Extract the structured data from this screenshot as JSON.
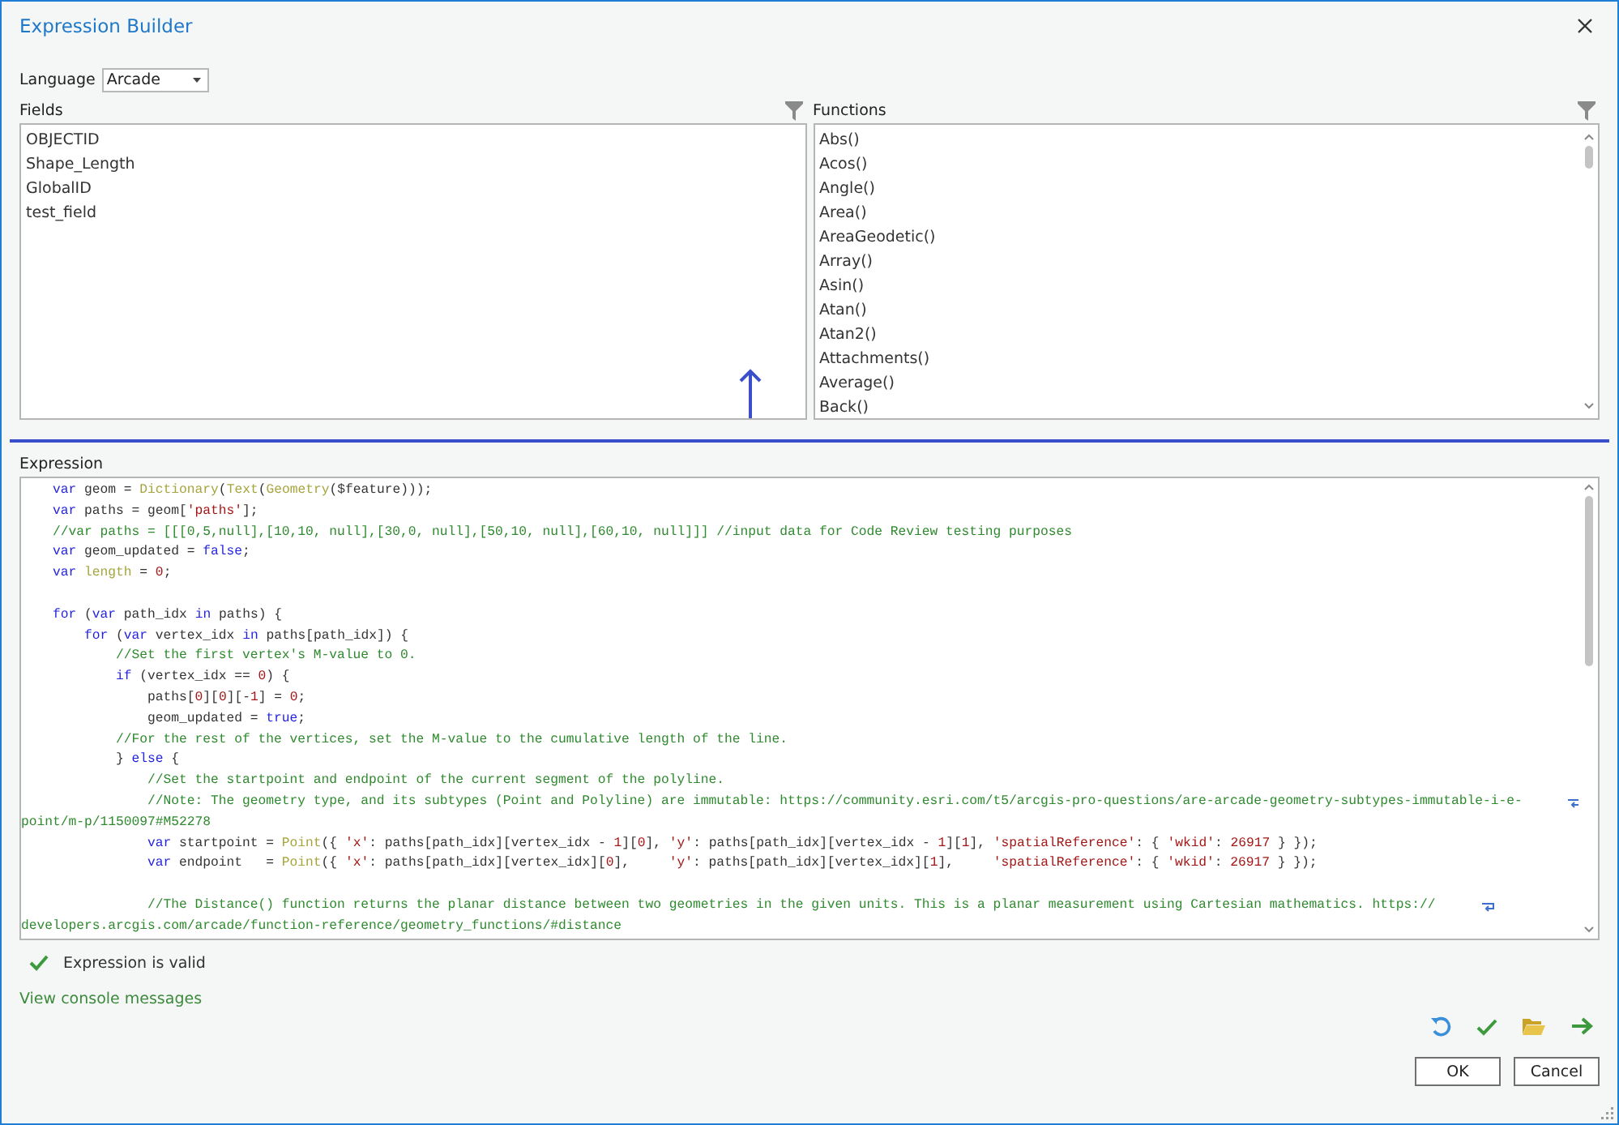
{
  "window": {
    "title": "Expression Builder"
  },
  "language": {
    "label": "Language",
    "value": "Arcade"
  },
  "fields": {
    "label": "Fields",
    "items": [
      "OBJECTID",
      "Shape_Length",
      "GlobalID",
      "test_field"
    ]
  },
  "functions": {
    "label": "Functions",
    "items": [
      "Abs()",
      "Acos()",
      "Angle()",
      "Area()",
      "AreaGeodetic()",
      "Array()",
      "Asin()",
      "Atan()",
      "Atan2()",
      "Attachments()",
      "Average()",
      "Back()"
    ]
  },
  "expression": {
    "label": "Expression",
    "lines": [
      {
        "kind": "code",
        "tokens": [
          {
            "kind": "kw",
            "text": "    var"
          },
          {
            "kind": "pl",
            "text": " geom = "
          },
          {
            "kind": "fn",
            "text": "Dictionary"
          },
          {
            "kind": "pl",
            "text": "("
          },
          {
            "kind": "fn",
            "text": "Text"
          },
          {
            "kind": "pl",
            "text": "("
          },
          {
            "kind": "fn",
            "text": "Geometry"
          },
          {
            "kind": "pl",
            "text": "($feature)));"
          }
        ]
      },
      {
        "kind": "code",
        "tokens": [
          {
            "kind": "kw",
            "text": "    var"
          },
          {
            "kind": "pl",
            "text": " paths = geom["
          },
          {
            "kind": "str",
            "text": "'paths'"
          },
          {
            "kind": "pl",
            "text": "];"
          }
        ]
      },
      {
        "kind": "code",
        "tokens": [
          {
            "kind": "com",
            "text": "    //var paths = [[[0,5,null],[10,10, null],[30,0, null],[50,10, null],[60,10, null]]] //input data for Code Review testing purposes"
          }
        ]
      },
      {
        "kind": "code",
        "tokens": [
          {
            "kind": "kw",
            "text": "    var"
          },
          {
            "kind": "pl",
            "text": " geom_updated = "
          },
          {
            "kind": "kw",
            "text": "false"
          },
          {
            "kind": "pl",
            "text": ";"
          }
        ]
      },
      {
        "kind": "code",
        "tokens": [
          {
            "kind": "kw",
            "text": "    var "
          },
          {
            "kind": "fn",
            "text": "length"
          },
          {
            "kind": "pl",
            "text": " = "
          },
          {
            "kind": "num",
            "text": "0"
          },
          {
            "kind": "pl",
            "text": ";"
          }
        ]
      },
      {
        "kind": "blank"
      },
      {
        "kind": "code",
        "tokens": [
          {
            "kind": "kw",
            "text": "    for"
          },
          {
            "kind": "pl",
            "text": " ("
          },
          {
            "kind": "kw",
            "text": "var"
          },
          {
            "kind": "pl",
            "text": " path_idx "
          },
          {
            "kind": "kw",
            "text": "in"
          },
          {
            "kind": "pl",
            "text": " paths) {"
          }
        ]
      },
      {
        "kind": "code",
        "tokens": [
          {
            "kind": "kw",
            "text": "        for"
          },
          {
            "kind": "pl",
            "text": " ("
          },
          {
            "kind": "kw",
            "text": "var"
          },
          {
            "kind": "pl",
            "text": " vertex_idx "
          },
          {
            "kind": "kw",
            "text": "in"
          },
          {
            "kind": "pl",
            "text": " paths[path_idx]) {"
          }
        ]
      },
      {
        "kind": "code",
        "tokens": [
          {
            "kind": "com",
            "text": "            //Set the first vertex's M-value to 0."
          }
        ]
      },
      {
        "kind": "code",
        "tokens": [
          {
            "kind": "kw",
            "text": "            if"
          },
          {
            "kind": "pl",
            "text": " (vertex_idx == "
          },
          {
            "kind": "num",
            "text": "0"
          },
          {
            "kind": "pl",
            "text": ") {"
          }
        ]
      },
      {
        "kind": "code",
        "tokens": [
          {
            "kind": "pl",
            "text": "                paths["
          },
          {
            "kind": "num",
            "text": "0"
          },
          {
            "kind": "pl",
            "text": "]["
          },
          {
            "kind": "num",
            "text": "0"
          },
          {
            "kind": "pl",
            "text": "][-"
          },
          {
            "kind": "num",
            "text": "1"
          },
          {
            "kind": "pl",
            "text": "] = "
          },
          {
            "kind": "num",
            "text": "0"
          },
          {
            "kind": "pl",
            "text": ";"
          }
        ]
      },
      {
        "kind": "code",
        "tokens": [
          {
            "kind": "pl",
            "text": "                geom_updated = "
          },
          {
            "kind": "kw",
            "text": "true"
          },
          {
            "kind": "pl",
            "text": ";"
          }
        ]
      },
      {
        "kind": "code",
        "tokens": [
          {
            "kind": "com",
            "text": "            //For the rest of the vertices, set the M-value to the cumulative length of the line."
          }
        ]
      },
      {
        "kind": "code",
        "tokens": [
          {
            "kind": "pl",
            "text": "            } "
          },
          {
            "kind": "kw",
            "text": "else"
          },
          {
            "kind": "pl",
            "text": " {"
          }
        ]
      },
      {
        "kind": "code",
        "tokens": [
          {
            "kind": "com",
            "text": "                //Set the startpoint and endpoint of the current segment of the polyline."
          }
        ]
      },
      {
        "kind": "code",
        "wrapped": true,
        "tokens": [
          {
            "kind": "com",
            "text": "                //Note: The geometry type, and its subtypes (Point and Polyline) are immutable: https://community.esri.com/t5/arcgis-pro-questions/are-arcade-geometry-subtypes-immutable-i-e-"
          }
        ]
      },
      {
        "kind": "code",
        "tokens": [
          {
            "kind": "com",
            "text": "point/m-p/1150097#M52278"
          }
        ]
      },
      {
        "kind": "code",
        "tokens": [
          {
            "kind": "kw",
            "text": "                var"
          },
          {
            "kind": "pl",
            "text": " startpoint = "
          },
          {
            "kind": "fn",
            "text": "Point"
          },
          {
            "kind": "pl",
            "text": "({ "
          },
          {
            "kind": "str",
            "text": "'x'"
          },
          {
            "kind": "pl",
            "text": ": paths[path_idx][vertex_idx - "
          },
          {
            "kind": "num",
            "text": "1"
          },
          {
            "kind": "pl",
            "text": "]["
          },
          {
            "kind": "num",
            "text": "0"
          },
          {
            "kind": "pl",
            "text": "], "
          },
          {
            "kind": "str",
            "text": "'y'"
          },
          {
            "kind": "pl",
            "text": ": paths[path_idx][vertex_idx - "
          },
          {
            "kind": "num",
            "text": "1"
          },
          {
            "kind": "pl",
            "text": "]["
          },
          {
            "kind": "num",
            "text": "1"
          },
          {
            "kind": "pl",
            "text": "], "
          },
          {
            "kind": "str",
            "text": "'spatialReference'"
          },
          {
            "kind": "pl",
            "text": ": { "
          },
          {
            "kind": "str",
            "text": "'wkid'"
          },
          {
            "kind": "pl",
            "text": ": "
          },
          {
            "kind": "num",
            "text": "26917"
          },
          {
            "kind": "pl",
            "text": " } });"
          }
        ]
      },
      {
        "kind": "code",
        "tokens": [
          {
            "kind": "kw",
            "text": "                var"
          },
          {
            "kind": "pl",
            "text": " endpoint   = "
          },
          {
            "kind": "fn",
            "text": "Point"
          },
          {
            "kind": "pl",
            "text": "({ "
          },
          {
            "kind": "str",
            "text": "'x'"
          },
          {
            "kind": "pl",
            "text": ": paths[path_idx][vertex_idx]["
          },
          {
            "kind": "num",
            "text": "0"
          },
          {
            "kind": "pl",
            "text": "],     "
          },
          {
            "kind": "str",
            "text": "'y'"
          },
          {
            "kind": "pl",
            "text": ": paths[path_idx][vertex_idx]["
          },
          {
            "kind": "num",
            "text": "1"
          },
          {
            "kind": "pl",
            "text": "],     "
          },
          {
            "kind": "str",
            "text": "'spatialReference'"
          },
          {
            "kind": "pl",
            "text": ": { "
          },
          {
            "kind": "str",
            "text": "'wkid'"
          },
          {
            "kind": "pl",
            "text": ": "
          },
          {
            "kind": "num",
            "text": "26917"
          },
          {
            "kind": "pl",
            "text": " } });"
          }
        ]
      },
      {
        "kind": "blank"
      },
      {
        "kind": "code",
        "wrapped": true,
        "tokens": [
          {
            "kind": "com",
            "text": "                //The Distance() function returns the planar distance between two geometries in the given units. This is a planar measurement using Cartesian mathematics. https://"
          }
        ]
      },
      {
        "kind": "code",
        "tokens": [
          {
            "kind": "com",
            "text": "developers.arcgis.com/arcade/function-reference/geometry_functions/#distance"
          }
        ]
      }
    ]
  },
  "validation": {
    "valid": true,
    "message": "Expression is valid"
  },
  "console_link": "View console messages",
  "buttons": [
    "OK",
    "Cancel"
  ]
}
